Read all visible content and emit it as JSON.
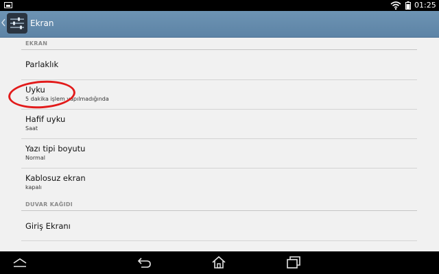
{
  "status_bar": {
    "time": "01:25",
    "icons": [
      "screenshot-icon",
      "wifi-icon",
      "battery-icon"
    ]
  },
  "action_bar": {
    "title": "Ekran",
    "icons": [
      "back-chevron-icon",
      "settings-sliders-icon"
    ]
  },
  "sections": [
    {
      "header": "EKRAN",
      "items": [
        {
          "title": "Parlaklık",
          "subtitle": ""
        },
        {
          "title": "Uyku",
          "subtitle": "5 dakika işlem yapılmadığında"
        },
        {
          "title": "Hafif uyku",
          "subtitle": "Saat"
        },
        {
          "title": "Yazı tipi boyutu",
          "subtitle": "Normal"
        },
        {
          "title": "Kablosuz ekran",
          "subtitle": "kapalı"
        }
      ]
    },
    {
      "header": "DUVAR KAĞIDI",
      "items": [
        {
          "title": "Giriş Ekranı",
          "subtitle": ""
        }
      ]
    }
  ],
  "nav_bar": {
    "icons": [
      "chevron-up-icon",
      "back-icon",
      "home-icon",
      "recent-apps-icon"
    ]
  },
  "colors": {
    "action_bar": "#6389ab",
    "background": "#f1f1f1",
    "annotation": "#e21b1b"
  }
}
